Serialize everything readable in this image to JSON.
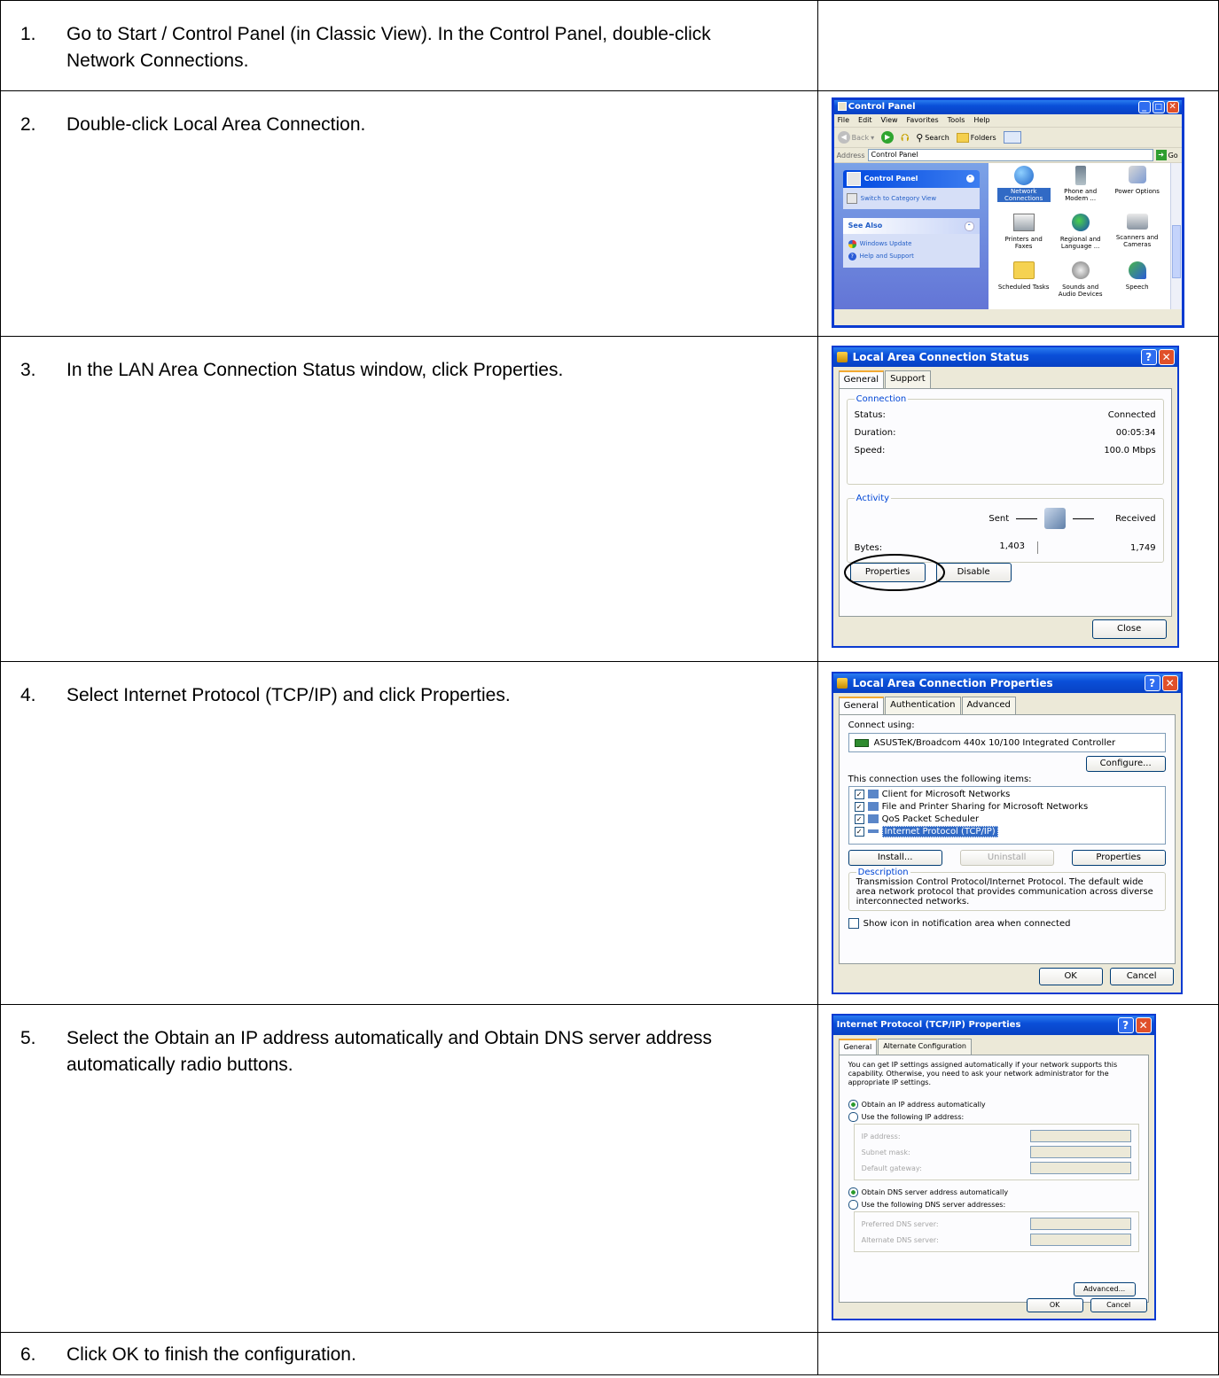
{
  "steps": [
    {
      "num": "1.",
      "text": "Go to Start / Control Panel (in Classic View). In the Control Panel, double-click Network Connections."
    },
    {
      "num": "2.",
      "text": "Double-click Local Area Connection."
    },
    {
      "num": "3.",
      "text": "In the LAN Area Connection Status window, click Properties."
    },
    {
      "num": "4.",
      "text": "Select Internet Protocol (TCP/IP) and click Properties."
    },
    {
      "num": "5.",
      "text": "Select the Obtain an IP address automatically and Obtain DNS server address automatically radio buttons."
    },
    {
      "num": "6.",
      "text": "Click OK to finish the configuration."
    }
  ],
  "control_panel": {
    "title": "Control Panel",
    "menu": [
      "File",
      "Edit",
      "View",
      "Favorites",
      "Tools",
      "Help"
    ],
    "toolbar": {
      "back": "Back",
      "search": "Search",
      "folders": "Folders"
    },
    "address_label": "Address",
    "address_value": "Control Panel",
    "go": "Go",
    "sidebar": {
      "panel_title": "Control Panel",
      "switch_link": "Switch to Category View",
      "see_also": "See Also",
      "links": [
        "Windows Update",
        "Help and Support"
      ]
    },
    "icons": [
      {
        "label": "Network Connections",
        "icon": "network-globe"
      },
      {
        "label": "Phone and Modem ...",
        "icon": "phone"
      },
      {
        "label": "Power Options",
        "icon": "power-plug"
      },
      {
        "label": "Printers and Faxes",
        "icon": "printer"
      },
      {
        "label": "Regional and Language ...",
        "icon": "globe"
      },
      {
        "label": "Scanners and Cameras",
        "icon": "scanner"
      },
      {
        "label": "Scheduled Tasks",
        "icon": "folder-clock"
      },
      {
        "label": "Sounds and Audio Devices",
        "icon": "speaker"
      },
      {
        "label": "Speech",
        "icon": "speech"
      }
    ]
  },
  "status": {
    "title": "Local Area Connection Status",
    "tabs": [
      "General",
      "Support"
    ],
    "connection_legend": "Connection",
    "rows": [
      {
        "label": "Status:",
        "value": "Connected"
      },
      {
        "label": "Duration:",
        "value": "00:05:34"
      },
      {
        "label": "Speed:",
        "value": "100.0 Mbps"
      }
    ],
    "activity_legend": "Activity",
    "sent": "Sent",
    "received": "Received",
    "bytes_label": "Bytes:",
    "bytes_sent": "1,403",
    "bytes_received": "1,749",
    "properties": "Properties",
    "disable": "Disable",
    "close": "Close"
  },
  "lan_props": {
    "title": "Local Area Connection Properties",
    "tabs": [
      "General",
      "Authentication",
      "Advanced"
    ],
    "connect_using": "Connect using:",
    "adapter": "ASUSTeK/Broadcom 440x 10/100 Integrated Controller",
    "configure": "Configure...",
    "items_label": "This connection uses the following items:",
    "items": [
      "Client for Microsoft Networks",
      "File and Printer Sharing for Microsoft Networks",
      "QoS Packet Scheduler",
      "Internet Protocol (TCP/IP)"
    ],
    "install": "Install...",
    "uninstall": "Uninstall",
    "properties": "Properties",
    "description_legend": "Description",
    "description": "Transmission Control Protocol/Internet Protocol. The default wide area network protocol that provides communication across diverse interconnected networks.",
    "show_icon": "Show icon in notification area when connected",
    "ok": "OK",
    "cancel": "Cancel"
  },
  "tcpip": {
    "title": "Internet Protocol (TCP/IP) Properties",
    "tabs": [
      "General",
      "Alternate Configuration"
    ],
    "intro": "You can get IP settings assigned automatically if your network supports this capability. Otherwise, you need to ask your network administrator for the appropriate IP settings.",
    "obtain_ip": "Obtain an IP address automatically",
    "use_ip": "Use the following IP address:",
    "ip_fields": [
      "IP address:",
      "Subnet mask:",
      "Default gateway:"
    ],
    "obtain_dns": "Obtain DNS server address automatically",
    "use_dns": "Use the following DNS server addresses:",
    "dns_fields": [
      "Preferred DNS server:",
      "Alternate DNS server:"
    ],
    "advanced": "Advanced...",
    "ok": "OK",
    "cancel": "Cancel"
  }
}
